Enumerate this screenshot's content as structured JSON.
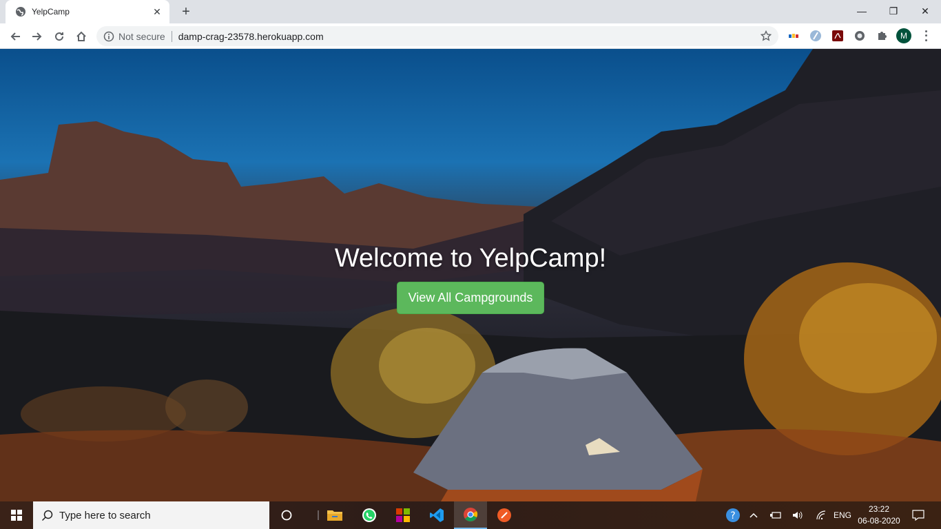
{
  "browser": {
    "tab_title": "YelpCamp",
    "security_label": "Not secure",
    "url": "damp-crag-23578.herokuapp.com",
    "profile_initial": "M"
  },
  "page": {
    "heading": "Welcome to YelpCamp!",
    "cta_label": "View All Campgrounds",
    "cta_color": "#5cb85c"
  },
  "taskbar": {
    "search_placeholder": "Type here to search",
    "language": "ENG",
    "time": "23:22",
    "date": "06-08-2020"
  }
}
